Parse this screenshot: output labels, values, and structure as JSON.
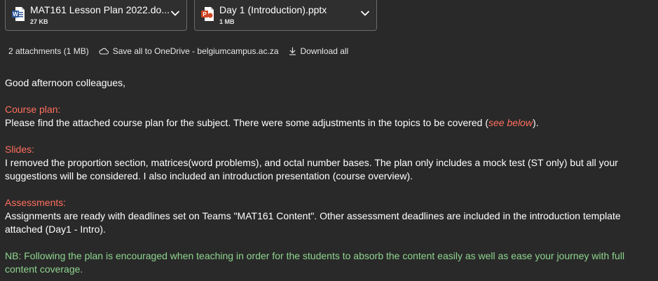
{
  "attachments": [
    {
      "name": "MAT161 Lesson Plan 2022.do...",
      "size": "27 KB",
      "type": "word-icon"
    },
    {
      "name": "Day 1 (Introduction).pptx",
      "size": "1 MB",
      "type": "powerpoint-icon"
    }
  ],
  "attachment_bar": {
    "count": "2 attachments (1 MB)",
    "save_onedrive": "Save all to OneDrive - belgiumcampus.ac.za",
    "download_all": "Download all"
  },
  "message": {
    "greeting": "Good afternoon colleagues,",
    "course_plan_heading": "Course plan:",
    "course_plan_text": "Please find the attached course plan for the subject. There were some adjustments in the topics to be covered (",
    "course_plan_link": "see below",
    "course_plan_end": ").",
    "slides_heading": "Slides:",
    "slides_text": "I removed the proportion section, matrices(word problems), and octal number bases. The plan only includes a mock test (ST only) but all your suggestions will be considered. I also included an introduction presentation (course overview).",
    "assessments_heading": "Assessments:",
    "assessments_text": "Assignments are ready with deadlines set on Teams \"MAT161 Content\".  Other assessment deadlines are included in the introduction template attached (Day1 - Intro).",
    "nb_text": "NB: Following the plan is encouraged when teaching in order for the students to absorb the content easily as well as ease your journey with full content coverage."
  },
  "colors": {
    "background": "#292929",
    "heading": "#ff6f5e",
    "nb": "#8fd48f",
    "word": "#2b579a",
    "powerpoint": "#d24726"
  }
}
